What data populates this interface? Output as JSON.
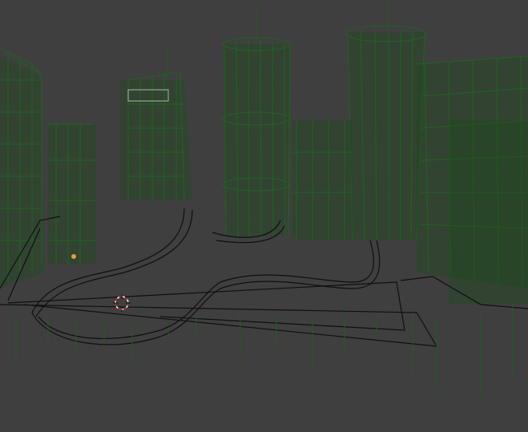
{
  "viewport": {
    "mode": "wireframe",
    "background_color": "#3f3f3f",
    "wire_color": "#1f5e1f",
    "road_color": "#0f0f0f"
  },
  "objects": {
    "cursor": {
      "name": "3d-cursor-icon"
    },
    "lamp": {
      "name": "lamp-icon",
      "color": "#e0a040"
    }
  }
}
